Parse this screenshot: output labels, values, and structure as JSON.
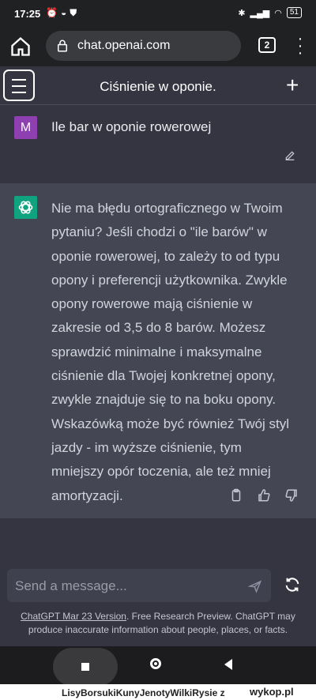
{
  "status_bar": {
    "time": "17:25",
    "battery": "51"
  },
  "browser": {
    "url": "chat.openai.com",
    "tab_count": "2"
  },
  "chat": {
    "title": "Ciśnienie w oponie.",
    "user_avatar": "M",
    "user_message": "Ile bar w oponie rowerowej",
    "assistant_message": "Nie ma błędu ortograficznego w Twoim pytaniu? Jeśli chodzi o \"ile barów\" w oponie rowerowej, to zależy to od typu opony i preferencji użytkownika. Zwykle opony rowerowe mają ciśnienie w zakresie od 3,5 do 8 barów. Możesz sprawdzić minimalne i maksymalne ciśnienie dla Twojej konkretnej opony, zwykle znajduje się to na boku opony. Wskazówką może być również Twój styl jazdy - im wyższe ciśnienie, tym mniejszy opór toczenia, ale też mniej amortyzacji."
  },
  "composer": {
    "placeholder": "Send a message...",
    "footer_link": "ChatGPT Mar 23 Version",
    "footer_text": ". Free Research Preview. ChatGPT may produce inaccurate information about people, places, or facts."
  },
  "watermark": {
    "user": "LisyBorsukiKunyJenotyWilkiRysie",
    "suffix": "z",
    "brand": "wykop.pl"
  },
  "colors": {
    "background": "#343541",
    "assistant_bg": "#444654",
    "user_avatar": "#8e3fb0",
    "gpt_logo": "#10a37f",
    "browser_bar": "#202123"
  },
  "icons": [
    "home-icon",
    "lock-icon",
    "tabs-icon",
    "menu-dots-icon",
    "hamburger-icon",
    "plus-icon",
    "edit-icon",
    "openai-logo-icon",
    "copy-icon",
    "thumbs-up-icon",
    "thumbs-down-icon",
    "send-icon",
    "regenerate-icon"
  ]
}
